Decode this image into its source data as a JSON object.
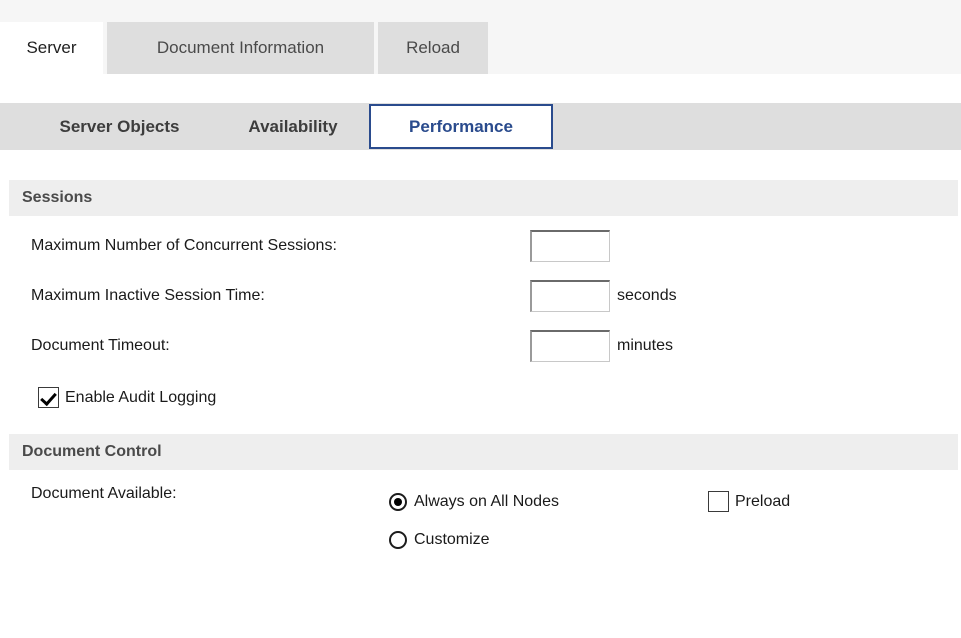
{
  "top_tabs": [
    {
      "label": "Server",
      "active": true
    },
    {
      "label": "Document Information",
      "active": false
    },
    {
      "label": "Reload",
      "active": false
    }
  ],
  "sub_tabs": [
    {
      "label": "Server Objects",
      "active": false
    },
    {
      "label": "Availability",
      "active": false
    },
    {
      "label": "Performance",
      "active": true
    }
  ],
  "sections": {
    "sessions": {
      "title": "Sessions",
      "fields": [
        {
          "label": "Maximum Number of Concurrent Sessions:",
          "value": "",
          "unit": ""
        },
        {
          "label": "Maximum Inactive Session Time:",
          "value": "",
          "unit": "seconds"
        },
        {
          "label": "Document Timeout:",
          "value": "",
          "unit": "minutes"
        }
      ],
      "audit_logging": {
        "label": "Enable Audit Logging",
        "checked": true
      }
    },
    "document_control": {
      "title": "Document Control",
      "document_available_label": "Document Available:",
      "options": [
        {
          "label": "Always on All Nodes",
          "selected": true
        },
        {
          "label": "Customize",
          "selected": false
        }
      ],
      "preload": {
        "label": "Preload",
        "checked": false
      }
    }
  },
  "colors": {
    "accent": "#2a4b8d",
    "tab_inactive_bg": "#dedede",
    "subbar_bg": "#dedede",
    "band_bg": "#eeeeee",
    "topbar_bg": "#f6f6f6",
    "text": "#1a1a1a"
  }
}
